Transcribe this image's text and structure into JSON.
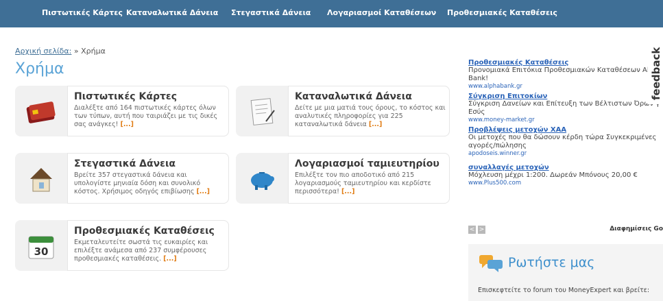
{
  "nav": [
    "Πιστωτικές Κάρτες",
    "Καταναλωτικά Δάνεια",
    "Στεγαστικά Δάνεια",
    "Λογαριασμοί Καταθέσεων",
    "Προθεσμιακές Καταθέσεις"
  ],
  "breadcrumb": {
    "home": "Αρχική σελίδα:",
    "sep": "»",
    "current": "Χρήμα"
  },
  "page_title": "Χρήμα",
  "cards": [
    {
      "title": "Πιστωτικές Κάρτες",
      "desc": "Διαλέξτε από 164 πιστωτικές κάρτες όλων των τύπων, αυτή που ταιριάζει με τις δικές σας ανάγκες!",
      "more": "[...]",
      "icon": "credit-card-icon"
    },
    {
      "title": "Καταναλωτικά Δάνεια",
      "desc": "Δείτε με μια ματιά τους όρους, το κόστος και αναλυτικές πληροφορίες για 225 καταναλωτικά δάνεια",
      "more": "[...]",
      "icon": "document-icon"
    },
    {
      "title": "Στεγαστικά Δάνεια",
      "desc": "Βρείτε 357 στεγαστικά δάνεια και υπολογίστε μηνιαία δόση και συνολικό κόστος. Χρήσιμος οδηγός επιβίωσης",
      "more": "[...]",
      "icon": "house-icon"
    },
    {
      "title": "Λογαριασμοί ταμιευτηρίου",
      "desc": "Επιλέξτε τον πιο αποδοτικό από 215 λογαριασμούς ταμιευτηρίου και κερδίστε περισσότερα!",
      "more": "[...]",
      "icon": "piggy-bank-icon"
    },
    {
      "title": "Προθεσμιακές Καταθέσεις",
      "desc": "Εκμεταλευτείτε σωστά τις ευκαιρίες και επιλέξτε ανάμεσα από 237 συμφέρουσες προθεσμιακές καταθέσεις.",
      "more": "[...]",
      "icon": "calendar-icon",
      "badge": "30"
    }
  ],
  "ads": [
    {
      "title": "Προθεσμιακές Καταθέσεις",
      "desc": "Προνομιακά Επιτόκια Προθεσμιακών Καταθέσεων Alpha Bank!",
      "url": "www.alphabank.gr"
    },
    {
      "title": "Σύγκριση Επιτοκίων",
      "desc": "Σύγκριση Δανείων και Επίτευξη των Βέλτιστων Όρων γ Εσύς",
      "url": "www.money-market.gr"
    },
    {
      "title": "Προβλέψεις μετοχών ΧΑΑ",
      "desc": "Οι μετοχές που θα δώσουν κέρδη τώρα Συγκεκριμένες αγορές/πώλησης",
      "url": "apodoseis.winner.gr"
    },
    {
      "title": "συναλλαγές μετοχών",
      "desc": "Μόχλευση μέχρι 1:200. Δωρεάν Μπόνους 20,00 €",
      "url": "www.Plus500.com"
    }
  ],
  "feedback": "feedback",
  "ad_nav": {
    "prev": "<",
    "next": ">",
    "label": "Διαφημίσεις Go"
  },
  "ask": {
    "title": "Ρωτήστε μας",
    "text": "Επισκεφτείτε το forum του MoneyExpert και βρείτε:"
  },
  "colors": {
    "nav_bg": "#3f6f96",
    "title": "#5aa3d6",
    "more": "#e07a10",
    "ad_link": "#2a63b8"
  }
}
